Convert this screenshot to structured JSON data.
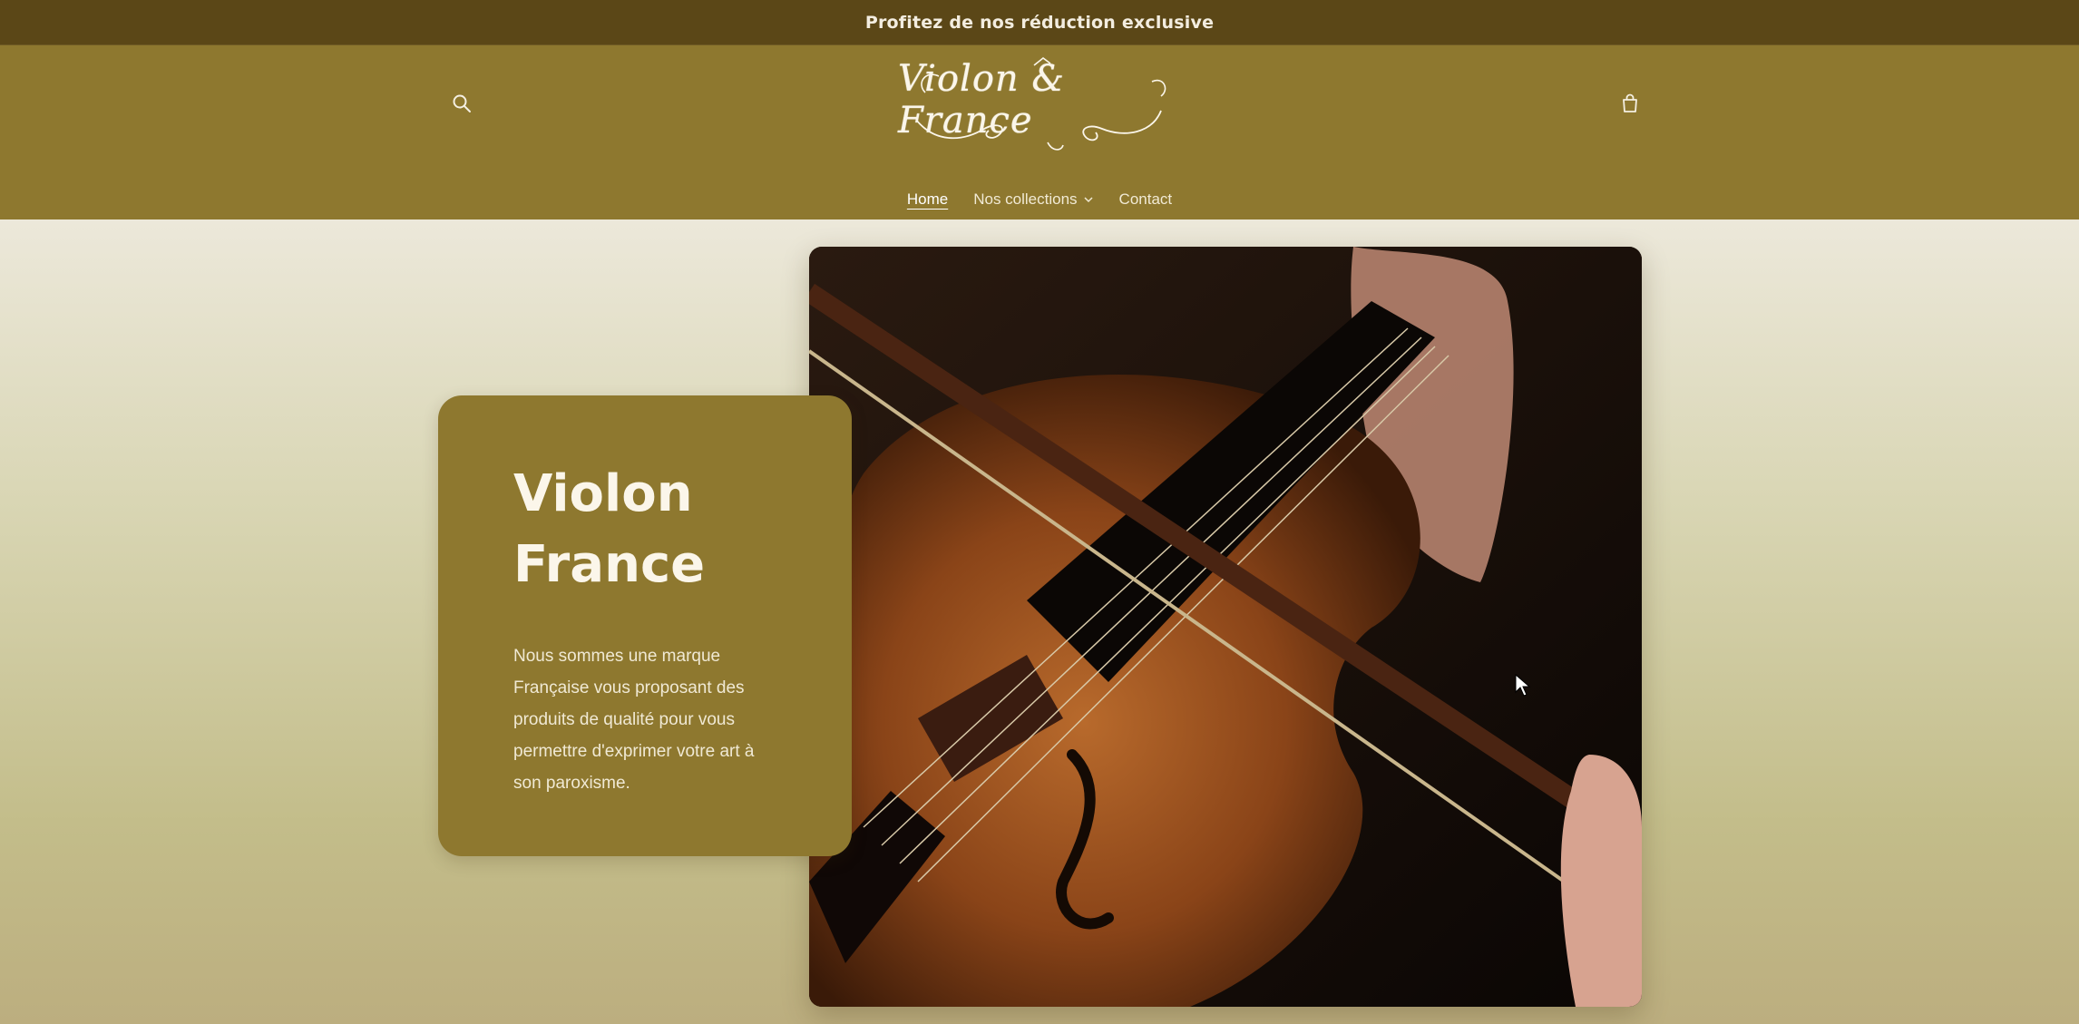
{
  "announcement": {
    "text": "Profitez de nos réduction exclusive"
  },
  "header": {
    "logo_text": "Violon & France",
    "search_icon": "search-icon",
    "cart_icon": "cart-icon"
  },
  "nav": {
    "items": [
      {
        "label": "Home",
        "active": true
      },
      {
        "label": "Nos collections",
        "has_dropdown": true
      },
      {
        "label": "Contact"
      }
    ]
  },
  "hero": {
    "title_line1": "Violon",
    "title_line2": "France",
    "description": "Nous sommes une marque Française vous proposant des produits de qualité pour vous permettre d'exprimer votre art à son paroxisme."
  },
  "colors": {
    "announcement_bg": "#5b4717",
    "header_bg": "#8e782f",
    "card_bg": "#8e782f",
    "text_light": "#fbf6ea"
  }
}
